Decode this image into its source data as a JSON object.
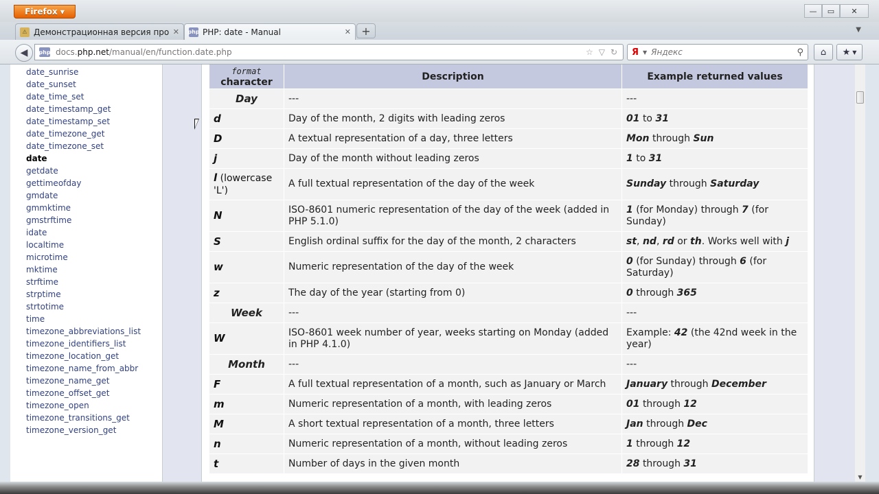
{
  "browser": {
    "menu_label": "Firefox",
    "tabs": [
      {
        "label": "Демонстрационная версия продукт…",
        "active": false
      },
      {
        "label": "PHP: date - Manual",
        "active": true
      }
    ],
    "url_prefix": "docs.",
    "url_domain": "php.net",
    "url_path": "/manual/en/function.date.php",
    "search_placeholder": "Яндекс",
    "search_engine_icon": "yandex-icon"
  },
  "sidebar": {
    "items": [
      {
        "label": "date_sunrise"
      },
      {
        "label": "date_sunset"
      },
      {
        "label": "date_time_set"
      },
      {
        "label": "date_timestamp_get"
      },
      {
        "label": "date_timestamp_set"
      },
      {
        "label": "date_timezone_get"
      },
      {
        "label": "date_timezone_set"
      },
      {
        "label": "date",
        "current": true
      },
      {
        "label": "getdate"
      },
      {
        "label": "gettimeofday"
      },
      {
        "label": "gmdate"
      },
      {
        "label": "gmmktime"
      },
      {
        "label": "gmstrftime"
      },
      {
        "label": "idate"
      },
      {
        "label": "localtime"
      },
      {
        "label": "microtime"
      },
      {
        "label": "mktime"
      },
      {
        "label": "strftime"
      },
      {
        "label": "strptime"
      },
      {
        "label": "strtotime"
      },
      {
        "label": "time"
      },
      {
        "label": "timezone_abbreviations_list"
      },
      {
        "label": "timezone_identifiers_list"
      },
      {
        "label": "timezone_location_get"
      },
      {
        "label": "timezone_name_from_abbr"
      },
      {
        "label": "timezone_name_get"
      },
      {
        "label": "timezone_offset_get"
      },
      {
        "label": "timezone_open"
      },
      {
        "label": "timezone_transitions_get"
      },
      {
        "label": "timezone_version_get"
      }
    ]
  },
  "table": {
    "header": {
      "col1_code": "format",
      "col1_label": "character",
      "col2": "Description",
      "col3": "Example returned values"
    },
    "rows": [
      {
        "type": "group",
        "c1": "Day",
        "c2": "---",
        "c3": "---"
      },
      {
        "c1": "d",
        "c2": "Day of the month, 2 digits with leading zeros",
        "c3": "01 to 31"
      },
      {
        "c1": "D",
        "c2": "A textual representation of a day, three letters",
        "c3": "Mon through Sun"
      },
      {
        "c1": "j",
        "c2": "Day of the month without leading zeros",
        "c3": "1 to 31"
      },
      {
        "c1": "l",
        "c1_note": " (lowercase 'L')",
        "c2": "A full textual representation of the day of the week",
        "c3": "Sunday through Saturday"
      },
      {
        "c1": "N",
        "c2": "ISO-8601 numeric representation of the day of the week (added in PHP 5.1.0)",
        "c3": "1 (for Monday) through 7 (for Sunday)"
      },
      {
        "c1": "S",
        "c2": "English ordinal suffix for the day of the month, 2 characters",
        "c3": "st, nd, rd or th. Works well with j"
      },
      {
        "c1": "w",
        "c2": "Numeric representation of the day of the week",
        "c3": "0 (for Sunday) through 6 (for Saturday)"
      },
      {
        "c1": "z",
        "c2": "The day of the year (starting from 0)",
        "c3": "0 through 365"
      },
      {
        "type": "group",
        "c1": "Week",
        "c2": "---",
        "c3": "---"
      },
      {
        "c1": "W",
        "c2": "ISO-8601 week number of year, weeks starting on Monday (added in PHP 4.1.0)",
        "c3": "Example: 42 (the 42nd week in the year)"
      },
      {
        "type": "group",
        "c1": "Month",
        "c2": "---",
        "c3": "---"
      },
      {
        "c1": "F",
        "c2": "A full textual representation of a month, such as January or March",
        "c3": "January through December"
      },
      {
        "c1": "m",
        "c2": "Numeric representation of a month, with leading zeros",
        "c3": "01 through 12"
      },
      {
        "c1": "M",
        "c2": "A short textual representation of a month, three letters",
        "c3": "Jan through Dec"
      },
      {
        "c1": "n",
        "c2": "Numeric representation of a month, without leading zeros",
        "c3": "1 through 12"
      },
      {
        "c1": "t",
        "c2": "Number of days in the given month",
        "c3": "28 through 31"
      }
    ]
  }
}
